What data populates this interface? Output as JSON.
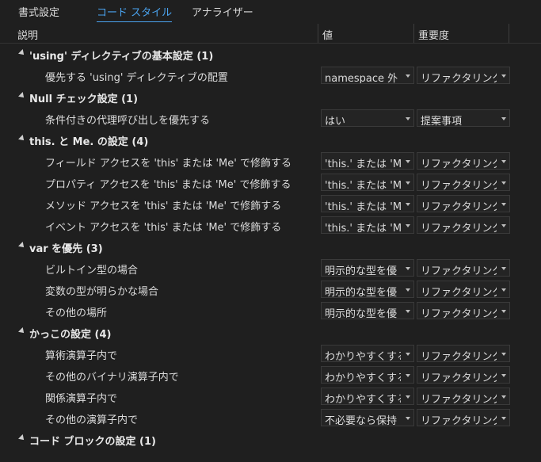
{
  "tabs": [
    {
      "label": "書式設定"
    },
    {
      "label": "コード スタイル"
    },
    {
      "label": "アナライザー"
    }
  ],
  "active_tab": 1,
  "columns": {
    "description": "説明",
    "value": "値",
    "severity": "重要度"
  },
  "rows": [
    {
      "type": "group",
      "label": "'using' ディレクティブの基本設定 (1)"
    },
    {
      "type": "item",
      "label": "優先する 'using' ディレクティブの配置",
      "value": "namespace 外",
      "severity": "リファクタリングの"
    },
    {
      "type": "group",
      "label": "Null チェック設定 (1)"
    },
    {
      "type": "item",
      "label": "条件付きの代理呼び出しを優先する",
      "value": "はい",
      "severity": "提案事項"
    },
    {
      "type": "group",
      "label": "this. と Me. の設定 (4)"
    },
    {
      "type": "item",
      "label": "フィールド アクセスを 'this' または 'Me' で修飾する",
      "value": "'this.' または 'Me",
      "severity": "リファクタリングの"
    },
    {
      "type": "item",
      "label": "プロパティ アクセスを 'this' または 'Me' で修飾する",
      "value": "'this.' または 'Me",
      "severity": "リファクタリングの"
    },
    {
      "type": "item",
      "label": "メソッド アクセスを 'this' または 'Me' で修飾する",
      "value": "'this.' または 'Me",
      "severity": "リファクタリングの"
    },
    {
      "type": "item",
      "label": "イベント アクセスを 'this' または 'Me' で修飾する",
      "value": "'this.' または 'Me",
      "severity": "リファクタリングの"
    },
    {
      "type": "group",
      "label": "var を優先 (3)"
    },
    {
      "type": "item",
      "label": "ビルトイン型の場合",
      "value": "明示的な型を優",
      "severity": "リファクタリングの"
    },
    {
      "type": "item",
      "label": "変数の型が明らかな場合",
      "value": "明示的な型を優",
      "severity": "リファクタリングの"
    },
    {
      "type": "item",
      "label": "その他の場所",
      "value": "明示的な型を優",
      "severity": "リファクタリングの"
    },
    {
      "type": "group",
      "label": "かっこの設定 (4)"
    },
    {
      "type": "item",
      "label": "算術演算子内で",
      "value": "わかりやすくするた",
      "severity": "リファクタリングの"
    },
    {
      "type": "item",
      "label": "その他のバイナリ演算子内で",
      "value": "わかりやすくするた",
      "severity": "リファクタリングの"
    },
    {
      "type": "item",
      "label": "関係演算子内で",
      "value": "わかりやすくするた",
      "severity": "リファクタリングの"
    },
    {
      "type": "item",
      "label": "その他の演算子内で",
      "value": "不必要なら保持",
      "severity": "リファクタリングの"
    },
    {
      "type": "group",
      "label": "コード ブロックの設定 (1)"
    }
  ]
}
